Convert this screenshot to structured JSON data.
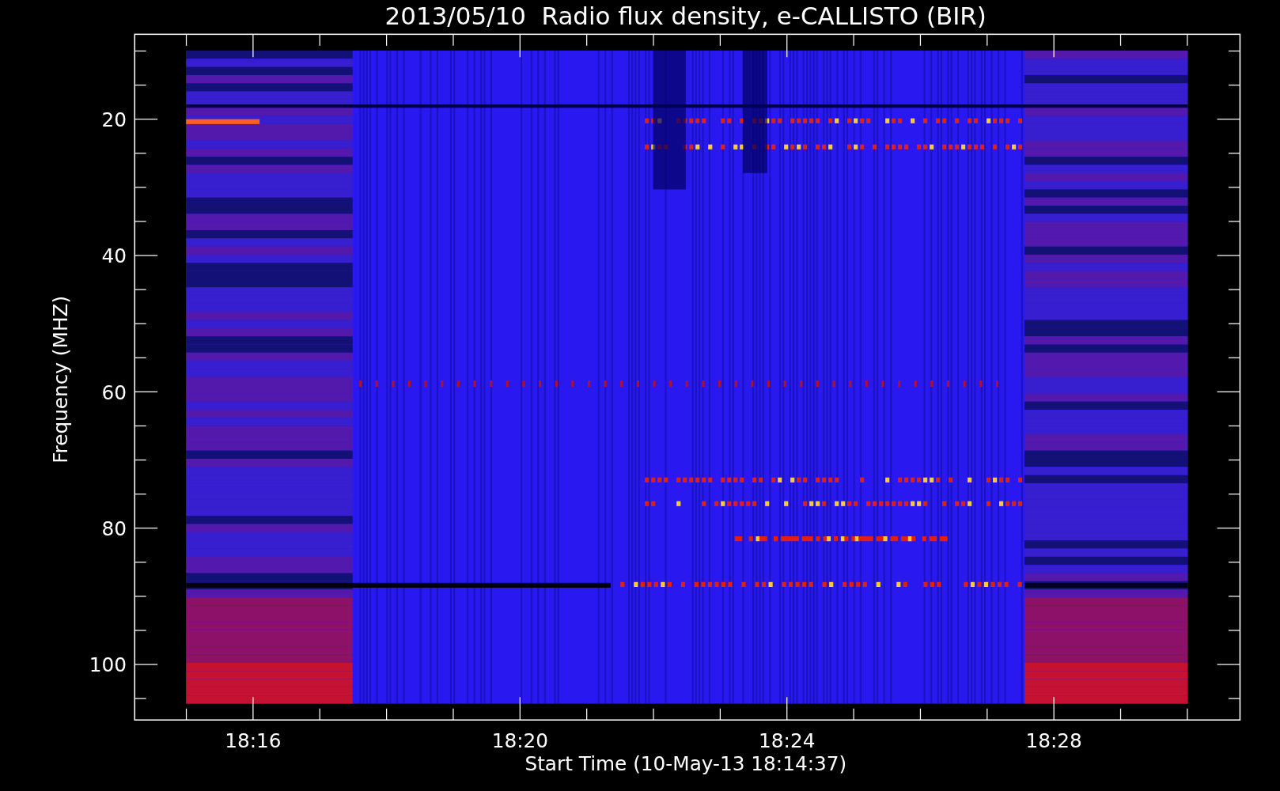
{
  "title": "2013/05/10  Radio flux density, e-CALLISTO (BIR)",
  "y_axis": {
    "label": "Frequency (MHZ)",
    "tick_labels": [
      "20",
      "40",
      "60",
      "80",
      "100"
    ]
  },
  "x_axis": {
    "label": "Start Time (10-May-13 18:14:37)",
    "tick_labels": [
      "18:16",
      "18:20",
      "18:24",
      "18:28"
    ]
  }
}
